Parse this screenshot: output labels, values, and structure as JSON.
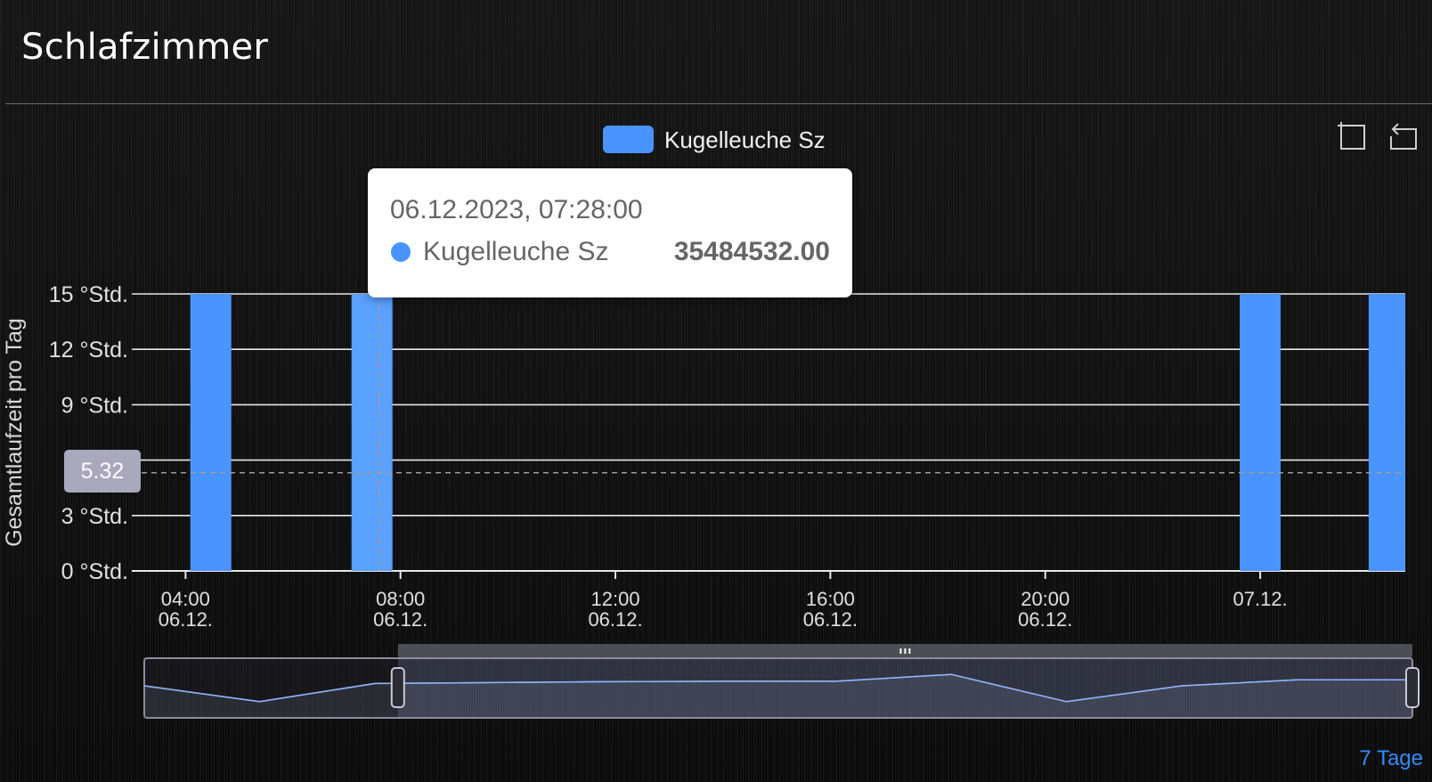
{
  "card": {
    "title": "Schlafzimmer",
    "footer_link": "7 Tage"
  },
  "toolbar": {
    "zoom_icon": "data-zoom-icon",
    "restore_icon": "restore-icon"
  },
  "tooltip": {
    "date": "06.12.2023, 07:28:00",
    "series": "Kugelleuche Sz",
    "value": "35484532.00"
  },
  "pointer": {
    "label": "5.32",
    "value": 5.32
  },
  "chart_data": {
    "type": "bar",
    "ylabel": "Gesamtlaufzeit pro Tag",
    "ylim": [
      0,
      15
    ],
    "ytick_values": [
      0,
      3,
      6,
      9,
      12,
      15
    ],
    "ytick_labels": [
      "0 °Std.",
      "3 °Std.",
      "9 °Std.",
      "12 °Std.",
      "15 °Std."
    ],
    "ytick_label_values": [
      0,
      3,
      9,
      12,
      15
    ],
    "xlim_hours": [
      3.0,
      26.7
    ],
    "xticks": [
      {
        "hour": 4,
        "line1": "04:00",
        "line2": "06.12."
      },
      {
        "hour": 8,
        "line1": "08:00",
        "line2": "06.12."
      },
      {
        "hour": 12,
        "line1": "12:00",
        "line2": "06.12."
      },
      {
        "hour": 16,
        "line1": "16:00",
        "line2": "06.12."
      },
      {
        "hour": 20,
        "line1": "20:00",
        "line2": "06.12."
      },
      {
        "hour": 24,
        "line1": "07.12.",
        "line2": ""
      }
    ],
    "legend": [
      "Kugelleuche Sz"
    ],
    "legend_position": "top-center",
    "series": [
      {
        "name": "Kugelleuche Sz",
        "color": "#4a94ff",
        "highlight_color": "#5aa0ff",
        "points": [
          {
            "x": "06.12. 04:28",
            "hour": 4.47,
            "value": 15
          },
          {
            "x": "06.12. 07:28",
            "hour": 7.47,
            "value": 15
          },
          {
            "x": "07.12. 00:00",
            "hour": 24.0,
            "value": 15
          },
          {
            "x": "07.12. 02:24",
            "hour": 26.4,
            "value": 15
          }
        ]
      }
    ],
    "highlighted_index": 1,
    "crosshair_hour": 7.6,
    "grid": true,
    "dataZoom": {
      "range_percent": [
        20,
        100
      ],
      "overview": [
        0.55,
        0.2,
        0.6,
        0.62,
        0.64,
        0.65,
        0.65,
        0.8,
        0.2,
        0.55,
        0.68,
        0.68
      ]
    }
  }
}
